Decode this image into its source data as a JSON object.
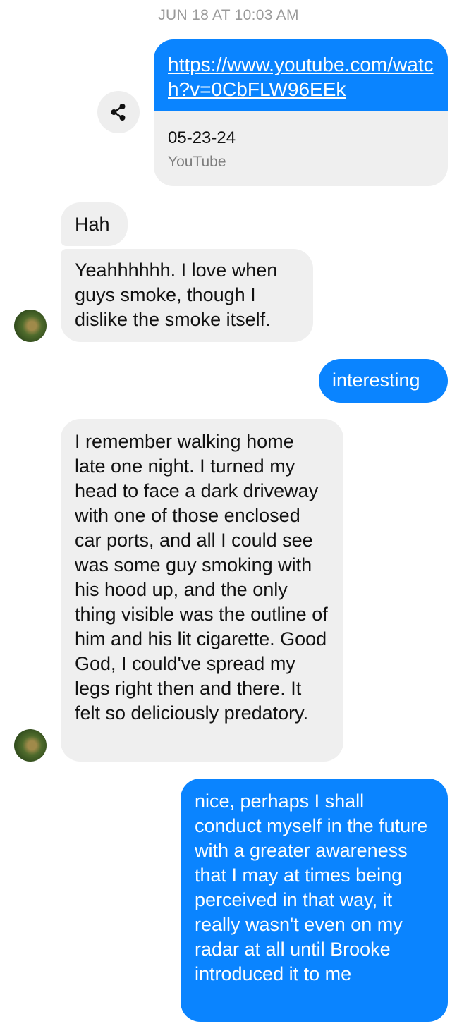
{
  "header": {
    "timestamp": "JUN 18 AT 10:03 AM"
  },
  "link_card": {
    "url": "https://www.youtube.com/watch?v=0CbFLW96EEk",
    "title": "05-23-24",
    "source": "YouTube",
    "share_icon": "share-icon",
    "colors": {
      "header_bg": "#0a84ff",
      "body_bg": "#efefef"
    }
  },
  "messages": [
    {
      "sender": "them",
      "text": "Hah"
    },
    {
      "sender": "them",
      "text": "Yeahhhhhh. I love when guys smoke, though I dislike the smoke itself."
    },
    {
      "sender": "me",
      "text": "interesting"
    },
    {
      "sender": "them",
      "text": "I remember walking home late one night. I turned my head to face a dark driveway with one of those enclosed car ports, and all I could see was some guy smoking with his hood up, and the only thing visible was the outline of him and his lit cigarette. Good God, I could've spread my legs right then and there. It felt so deliciously predatory."
    },
    {
      "sender": "me",
      "text": "nice, perhaps I shall conduct myself in the future with a greater awareness that I may at times being perceived in that way, it really wasn't even on my radar at all until Brooke introduced it to me"
    }
  ],
  "colors": {
    "outgoing_bubble": "#0a84ff",
    "incoming_bubble": "#efefef",
    "timestamp_text": "#9a9a9a"
  }
}
